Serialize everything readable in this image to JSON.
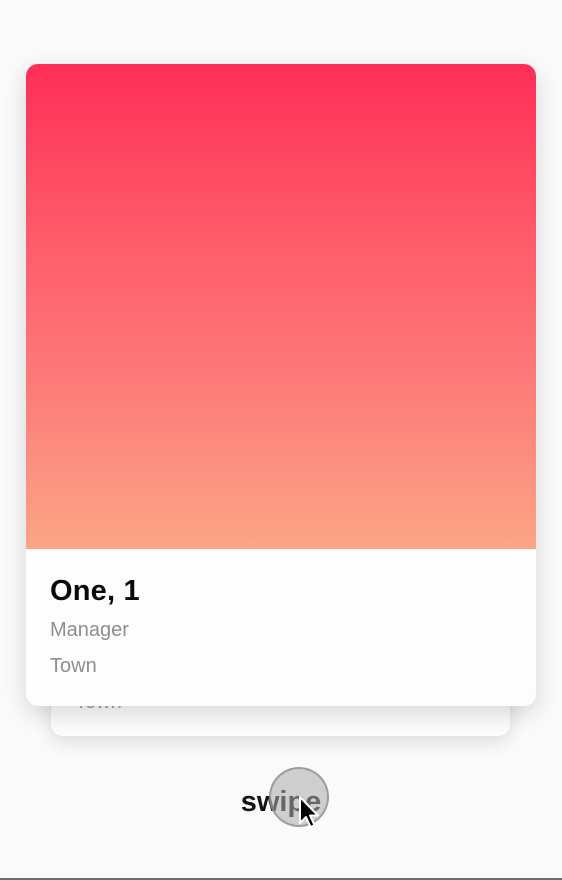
{
  "deck": {
    "back_card": {
      "location": "Town"
    },
    "front_card": {
      "name_age": "One, 1",
      "job": "Manager",
      "location": "Town",
      "photo_gradient_colors": [
        "#ff2e58",
        "#fca585"
      ]
    }
  },
  "swipe_label": "swipe",
  "cursor_icon": "arrow-pointer-icon"
}
